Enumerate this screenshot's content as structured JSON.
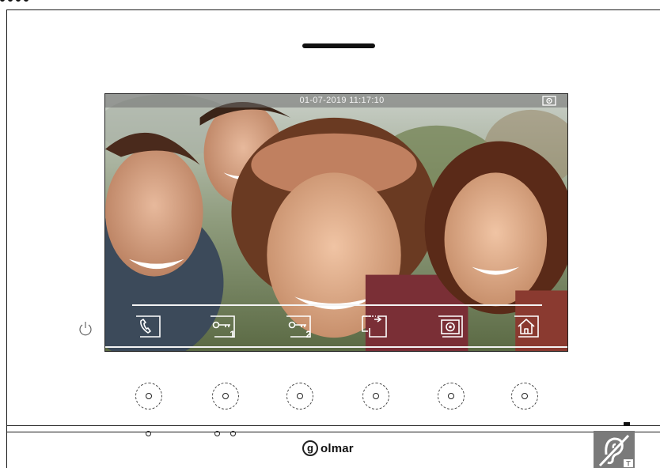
{
  "screen": {
    "datetime": "01-07-2019  11:17:10"
  },
  "toolbar": {
    "buttons": [
      {
        "name": "call",
        "icon": "phone-handset-icon",
        "sub": ""
      },
      {
        "name": "door-1",
        "icon": "key-icon",
        "sub": "1"
      },
      {
        "name": "door-2",
        "icon": "key-icon",
        "sub": "2"
      },
      {
        "name": "switch-camera",
        "icon": "camera-switch-icon",
        "sub": ""
      },
      {
        "name": "capture",
        "icon": "camera-capture-icon",
        "sub": ""
      },
      {
        "name": "home",
        "icon": "home-icon",
        "sub": ""
      }
    ]
  },
  "brand": {
    "symbol": "g",
    "name": "olmar"
  },
  "colors": {
    "frame": "#1a1a1a",
    "screen_overlay": "#f4f4f4"
  }
}
